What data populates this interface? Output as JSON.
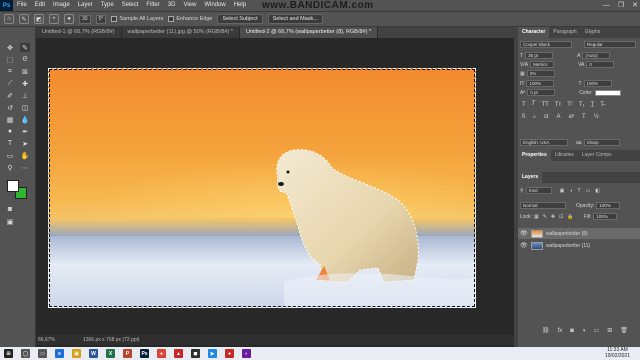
{
  "app": {
    "logo": "Ps",
    "watermark": "www.BANDICAM.com"
  },
  "menu": [
    "File",
    "Edit",
    "Image",
    "Layer",
    "Type",
    "Select",
    "Filter",
    "3D",
    "View",
    "Window",
    "Help"
  ],
  "window_controls": [
    "—",
    "❐",
    "✕"
  ],
  "options": {
    "brush_size": "30",
    "angle": "0°",
    "sample_all_layers": "Sample All Layers",
    "enhance_edge": "Enhance Edge",
    "select_subject": "Select Subject",
    "select_and_mask": "Select and Mask..."
  },
  "tabs": [
    {
      "label": "Untitled-1 @ 66,7% (RGB/8#)",
      "active": false
    },
    {
      "label": "wallpaperbetter (11).jpg @ 50% (RGB/8#) *",
      "active": false
    },
    {
      "label": "Untitled-2 @ 66,7% (wallpaperbetter (8), RGB/8#) *",
      "active": true
    }
  ],
  "status": {
    "zoom": "66,67%",
    "doc_size": "1366 px x 768 px (72 ppi)"
  },
  "character_panel": {
    "tabs": [
      "Character",
      "Paragraph",
      "Glyphs"
    ],
    "font_family": "Cooper Black",
    "font_style": "Regular",
    "font_size": "36 pt",
    "leading": "(Auto)",
    "kerning": "Metrics",
    "tracking": "0",
    "tracking_pct": "0%",
    "vscale": "100%",
    "hscale": "100%",
    "baseline": "0 pt",
    "color_label": "Color:",
    "language": "English: USA",
    "antialias": "Sharp"
  },
  "adjust_panel": {
    "tabs": [
      "Properties",
      "Libraries",
      "Layer Comps"
    ]
  },
  "layers_panel": {
    "tabs": [
      "Layers"
    ],
    "filter": "Kind",
    "blend_mode": "Normal",
    "opacity_label": "Opacity:",
    "opacity": "100%",
    "lock_label": "Lock:",
    "fill_label": "Fill:",
    "fill": "100%",
    "layers": [
      {
        "name": "wallpaperbetter (8)",
        "selected": true
      },
      {
        "name": "wallpaperbetter (11)",
        "selected": false
      }
    ]
  },
  "taskbar": {
    "time": "11:33 AM",
    "date": "19/02/2021",
    "apps": [
      {
        "label": "⊞",
        "color": "#222",
        "name": "start-icon"
      },
      {
        "label": "◯",
        "color": "#555",
        "name": "search-icon"
      },
      {
        "label": "▭",
        "color": "#555",
        "name": "task-view-icon"
      },
      {
        "label": "e",
        "color": "#1e6fd9",
        "name": "edge-icon"
      },
      {
        "label": "▣",
        "color": "#d4a017",
        "name": "file-explorer-icon"
      },
      {
        "label": "W",
        "color": "#2b579a",
        "name": "word-icon"
      },
      {
        "label": "X",
        "color": "#217346",
        "name": "excel-icon"
      },
      {
        "label": "P",
        "color": "#b7472a",
        "name": "powerpoint-icon"
      },
      {
        "label": "Ps",
        "color": "#001e36",
        "name": "photoshop-icon"
      },
      {
        "label": "●",
        "color": "#db4437",
        "name": "chrome-icon"
      },
      {
        "label": "▲",
        "color": "#c62828",
        "name": "app-icon"
      },
      {
        "label": "◼",
        "color": "#2d2d2d",
        "name": "app2-icon"
      },
      {
        "label": "▶",
        "color": "#1e88e5",
        "name": "media-icon"
      },
      {
        "label": "●",
        "color": "#c62828",
        "name": "bandicam-icon"
      },
      {
        "label": "◐",
        "color": "#6a1b9a",
        "name": "app3-icon"
      }
    ]
  },
  "colors": {
    "foreground": "#ffffff",
    "background": "#2fb52f",
    "accent": "#31a8ff"
  }
}
